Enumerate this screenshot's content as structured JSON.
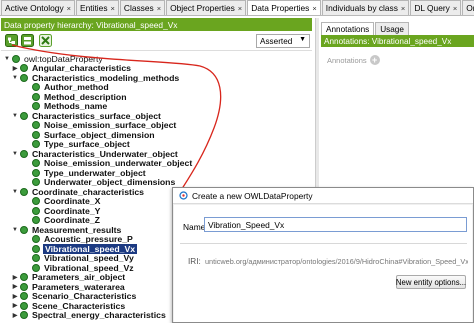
{
  "tabs": [
    {
      "label": "Active Ontology",
      "active": false
    },
    {
      "label": "Entities",
      "active": false
    },
    {
      "label": "Classes",
      "active": false
    },
    {
      "label": "Object Properties",
      "active": false
    },
    {
      "label": "Data Properties",
      "active": true
    },
    {
      "label": "Individuals by class",
      "active": false
    },
    {
      "label": "DL Query",
      "active": false
    },
    {
      "label": "OntoGraf",
      "active": false
    }
  ],
  "tab_close_glyph": "×",
  "hierarchy": {
    "header": "Data property hierarchy: Vibrational_speed_Vx",
    "view_mode": "Asserted",
    "toolbar_icons": [
      "add-sub-property-icon",
      "add-sibling-property-icon",
      "delete-property-icon"
    ]
  },
  "tree": [
    {
      "label": "owl:topDataProperty",
      "level": 0,
      "expanded": true,
      "root": true
    },
    {
      "label": "Angular_characteristics",
      "level": 1,
      "expanded": false
    },
    {
      "label": "Characteristics_modeling_methods",
      "level": 1,
      "expanded": true
    },
    {
      "label": "Author_method",
      "level": 2
    },
    {
      "label": "Method_description",
      "level": 2
    },
    {
      "label": "Methods_name",
      "level": 2
    },
    {
      "label": "Characteristics_surface_object",
      "level": 1,
      "expanded": true
    },
    {
      "label": "Noise_emission_surface_object",
      "level": 2
    },
    {
      "label": "Surface_object_dimension",
      "level": 2
    },
    {
      "label": "Type_surface_object",
      "level": 2
    },
    {
      "label": "Characteristics_Underwater_object",
      "level": 1,
      "expanded": true
    },
    {
      "label": "Noise_emission_underwater_object",
      "level": 2
    },
    {
      "label": "Type_underwater_object",
      "level": 2
    },
    {
      "label": "Underwater_object_dimensions",
      "level": 2
    },
    {
      "label": "Coordinate_characteristics",
      "level": 1,
      "expanded": true
    },
    {
      "label": "Coordinate_X",
      "level": 2
    },
    {
      "label": "Coordinate_Y",
      "level": 2
    },
    {
      "label": "Coordinate_Z",
      "level": 2
    },
    {
      "label": "Measurement_results",
      "level": 1,
      "expanded": true
    },
    {
      "label": "Acoustic_pressure_P",
      "level": 2
    },
    {
      "label": "Vibrational_speed_Vx",
      "level": 2,
      "selected": true
    },
    {
      "label": "Vibrational_speed_Vy",
      "level": 2
    },
    {
      "label": "Vibrational_speed_Vz",
      "level": 2
    },
    {
      "label": "Parameters_air_object",
      "level": 1,
      "expanded": false
    },
    {
      "label": "Parameters_waterarea",
      "level": 1,
      "expanded": false
    },
    {
      "label": "Scenario_Characteristics",
      "level": 1,
      "expanded": false
    },
    {
      "label": "Scene_Characteristics",
      "level": 1,
      "expanded": false
    },
    {
      "label": "Spectral_energy_characteristics",
      "level": 1,
      "expanded": false
    }
  ],
  "annotations_panel": {
    "tabs": [
      {
        "label": "Annotations",
        "active": true
      },
      {
        "label": "Usage",
        "active": false
      }
    ],
    "header": "Annotations: Vibrational_speed_Vx",
    "row_label": "Annotations",
    "add_glyph": "+"
  },
  "dialog": {
    "title": "Create a new OWLDataProperty",
    "name_label": "Name:",
    "name_value": "Vibration_Speed_Vx",
    "iri_label": "IRI:",
    "iri_value": "unticweb.org/администратор/ontologies/2016/9/HidroChina#Vibration_Speed_Vx",
    "new_entity_options_label": "New entity options..."
  },
  "colors": {
    "header_green": "#6aa51f",
    "selection_blue": "#1c3a82",
    "property_dot": "#3c9c3c",
    "annotation_line": "#d8261c"
  },
  "glyphs": {
    "expanded": "▼",
    "collapsed": "▶",
    "dropdown": "▼"
  }
}
